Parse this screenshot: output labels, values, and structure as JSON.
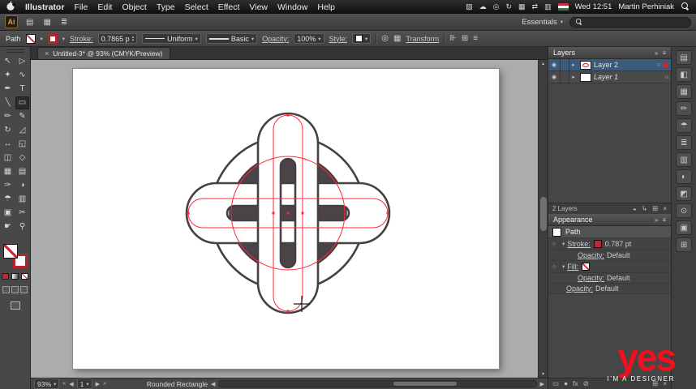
{
  "colors": {
    "accent_red": "#d2242c",
    "selection_blue": "#3c5a7a",
    "watermark_red": "#f30f1e"
  },
  "menubar": {
    "items": [
      "Illustrator",
      "File",
      "Edit",
      "Object",
      "Type",
      "Select",
      "Effect",
      "View",
      "Window",
      "Help"
    ],
    "status_icons": [
      "▨",
      "☁",
      "◎",
      "↻",
      "▦",
      "⇄",
      "▥"
    ],
    "clock": "Wed 12:51",
    "user": "Martin Perhiniak"
  },
  "appbar": {
    "logo": "Ai",
    "icons": [
      "▤",
      "▦",
      "≣"
    ],
    "workspace_label": "Essentials"
  },
  "controlbar": {
    "selection_type": "Path",
    "stroke_label": "Stroke:",
    "stroke_value": "0.7865 p",
    "variable_width": "Uniform",
    "brush_definition": "Basic",
    "opacity_label": "Opacity:",
    "opacity_value": "100%",
    "style_label": "Style:",
    "transform_label": "Transform",
    "icons": [
      "◎",
      "▦",
      "⊪",
      "⊞",
      "≡"
    ]
  },
  "tab": {
    "close": "×",
    "title": "Untitled-3* @ 93% (CMYK/Preview)"
  },
  "tools": [
    {
      "name": "selection",
      "glyph": "↖"
    },
    {
      "name": "direct-selection",
      "glyph": "▷"
    },
    {
      "name": "magic-wand",
      "glyph": "✦"
    },
    {
      "name": "lasso",
      "glyph": "∿"
    },
    {
      "name": "pen",
      "glyph": "✒"
    },
    {
      "name": "type",
      "glyph": "T"
    },
    {
      "name": "line-segment",
      "glyph": "╲"
    },
    {
      "name": "rectangle",
      "glyph": "▭"
    },
    {
      "name": "paintbrush",
      "glyph": "✏"
    },
    {
      "name": "pencil",
      "glyph": "✎"
    },
    {
      "name": "rotate",
      "glyph": "↻"
    },
    {
      "name": "scale",
      "glyph": "◿"
    },
    {
      "name": "width",
      "glyph": "↔"
    },
    {
      "name": "free-transform",
      "glyph": "◱"
    },
    {
      "name": "shape-builder",
      "glyph": "◫"
    },
    {
      "name": "perspective-grid",
      "glyph": "◇"
    },
    {
      "name": "mesh",
      "glyph": "▦"
    },
    {
      "name": "gradient",
      "glyph": "▤"
    },
    {
      "name": "eyedropper",
      "glyph": "✑"
    },
    {
      "name": "blend",
      "glyph": "◑"
    },
    {
      "name": "symbol-sprayer",
      "glyph": "☂"
    },
    {
      "name": "column-graph",
      "glyph": "▥"
    },
    {
      "name": "artboard",
      "glyph": "▣"
    },
    {
      "name": "slice",
      "glyph": "✂"
    },
    {
      "name": "hand",
      "glyph": "☛"
    },
    {
      "name": "zoom",
      "glyph": "⚲"
    }
  ],
  "layers_panel": {
    "title": "Layers",
    "rows": [
      {
        "name": "Layer 2"
      },
      {
        "name": "Layer 1"
      }
    ],
    "footer_count": "2 Layers",
    "footer_icons": [
      "◒",
      "↳",
      "⊞",
      "×"
    ]
  },
  "appearance_panel": {
    "title": "Appearance",
    "path_label": "Path",
    "stroke_label": "Stroke:",
    "stroke_value": "0.787 pt",
    "fill_label": "Fill:",
    "opacity_label": "Opacity:",
    "opacity_value": "Default",
    "footer_icons": [
      "▭",
      "●",
      "fx",
      "⊘",
      "⊞",
      "×"
    ]
  },
  "statusbar": {
    "zoom": "93%",
    "artboard": "1",
    "status": "Rounded Rectangle"
  },
  "strip_icons": [
    {
      "name": "color",
      "glyph": "▤"
    },
    {
      "name": "color-guide",
      "glyph": "◧"
    },
    {
      "name": "swatches",
      "glyph": "▦"
    },
    {
      "name": "brushes",
      "glyph": "✏"
    },
    {
      "name": "symbols",
      "glyph": "☂"
    },
    {
      "name": "stroke",
      "glyph": "≣"
    },
    {
      "name": "gradient",
      "glyph": "▥"
    },
    {
      "name": "transparency",
      "glyph": "◐"
    },
    {
      "name": "graphic-styles",
      "glyph": "◩"
    },
    {
      "name": "links",
      "glyph": "⊙"
    },
    {
      "name": "artboards",
      "glyph": "▣"
    },
    {
      "name": "navigator",
      "glyph": "⊞"
    }
  ],
  "glyphs": {
    "chevron_down": "▾",
    "chevron_up": "▴",
    "panel_menu": "≡",
    "left": "◀",
    "right": "▶",
    "first": "«",
    "last": "»",
    "eye": "◉",
    "disclosure": "▸",
    "target": "○"
  },
  "watermark": {
    "word": "yes",
    "tagline": "I'M A DESIGNER"
  }
}
